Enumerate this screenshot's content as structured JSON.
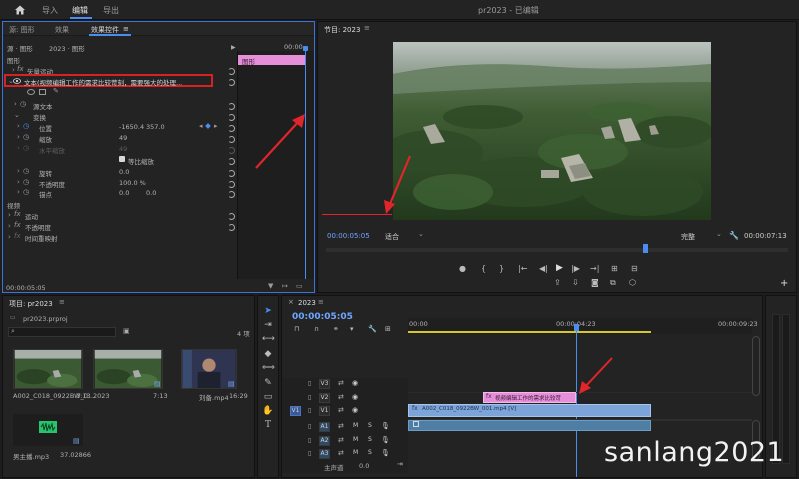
{
  "topbar": {
    "workspaces": [
      "导入",
      "编辑",
      "导出"
    ],
    "active_workspace": "编辑",
    "title": "pr2023 - 已编辑"
  },
  "effect_controls": {
    "tabs": [
      "源: 图形",
      "效果",
      "效果控件",
      "≡"
    ],
    "header": {
      "source": "源 · 图形",
      "sequence": "2023 · 图形",
      "time": "00:00"
    },
    "clip_bar_label": "图形",
    "section_graphic": "图形",
    "shape_motion": "矢量运动",
    "text_layer": "文本(视频编辑工作的需求比较苛刻，需要强大的处理...",
    "source_text": "源文本",
    "transform": "变换",
    "position_label": "位置",
    "position_x": "-1650.4",
    "position_y": "357.0",
    "scale_label": "缩放",
    "scale_value": "49",
    "scale_width_label": "水平缩放",
    "scale_width_value": "49",
    "uniform_scale_label": "等比缩放",
    "rotation_label": "旋转",
    "rotation_value": "0.0",
    "opacity_label": "不透明度",
    "opacity_value": "100.0 %",
    "anchor_label": "锚点",
    "anchor_x": "0.0",
    "anchor_y": "0.0",
    "section_video": "视频",
    "video_motion": "运动",
    "video_opacity": "不透明度",
    "time_remap": "时间重映射",
    "timecode": "00:00:05:05"
  },
  "program_monitor": {
    "title": "节目: 2023",
    "timecode": "00:00:05:05",
    "fit": "适合",
    "quality": "完整",
    "duration": "00:00:07:13"
  },
  "project": {
    "title": "项目: pr2023",
    "file": "pr2023.prproj",
    "count": "4 项",
    "items": [
      {
        "name": "A002_C018_0922BW_0...",
        "duration": "7:13"
      },
      {
        "name": "2023",
        "duration": "7:13"
      },
      {
        "name": "刘备.mp4",
        "duration": "16:29"
      },
      {
        "name": "男主播.mp3",
        "duration": "37.02866"
      }
    ]
  },
  "timeline": {
    "title": "2023",
    "timecode": "00:00:05:05",
    "ruler": [
      "00:00",
      "00:00:04:23",
      "00:00:09:23"
    ],
    "tracks_video": [
      "V3",
      "V2",
      "V1"
    ],
    "tracks_audio": [
      "A1",
      "A2",
      "A3"
    ],
    "source_patch": "V1",
    "master": "主声道",
    "master_value": "0.0",
    "title_clip": "视频编辑工作的需求比较苛",
    "video_clip": "A002_C018_0922BW_001.mp4 [V]"
  },
  "watermark": "sanlang2021",
  "colors": {
    "accent": "#3a74d6",
    "timecode": "#4a8cf0",
    "playhead": "#4a8cf0",
    "clip_pink": "#e48fd7",
    "clip_blue": "#7da4d8",
    "audio_clip": "#4e7ea3",
    "highlight": "#d82222"
  }
}
